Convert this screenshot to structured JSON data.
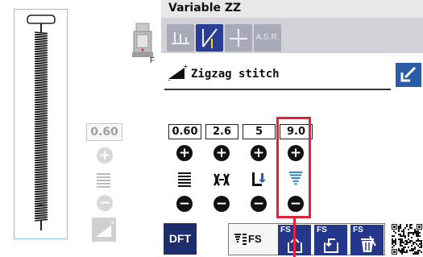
{
  "window": {
    "title": "Variable ZZ"
  },
  "tabs": [
    {
      "name": "straight-stitch-tab",
      "icon": "straight-stitch-icon"
    },
    {
      "name": "zigzag-tab",
      "icon": "zigzag-icon",
      "selected": true
    },
    {
      "name": "cross-tab",
      "icon": "cross-icon"
    },
    {
      "name": "asr-tab",
      "label": "A.S.R."
    }
  ],
  "stitch": {
    "name": "Zigzag stitch",
    "mirror_icon": "mirror-icon"
  },
  "preview": {
    "foot_letter": "F",
    "width_value": "0.60"
  },
  "controls": [
    {
      "value": "0.60",
      "icon": "stitch-density-icon"
    },
    {
      "value": "2.6",
      "icon": "stitch-spacing-icon"
    },
    {
      "value": "5",
      "icon": "needle-position-icon"
    },
    {
      "value": "9.0",
      "icon": "taper-density-icon",
      "highlighted": true
    }
  ],
  "bottom": {
    "dft_label": "DFT",
    "fs_toggle_label": "FS",
    "fs_buttons": [
      "FS",
      "FS",
      "FS"
    ]
  },
  "colors": {
    "accent": "#2a3e96",
    "highlight": "#e5203b",
    "mirror": "#2a5ca8"
  }
}
